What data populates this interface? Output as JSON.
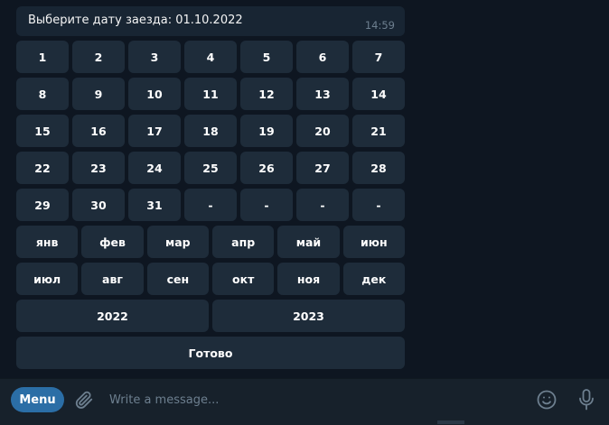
{
  "message": {
    "text": "Выберите дату заезда: 01.10.2022",
    "time": "14:59"
  },
  "keyboard": {
    "day_rows": [
      [
        "1",
        "2",
        "3",
        "4",
        "5",
        "6",
        "7"
      ],
      [
        "8",
        "9",
        "10",
        "11",
        "12",
        "13",
        "14"
      ],
      [
        "15",
        "16",
        "17",
        "18",
        "19",
        "20",
        "21"
      ],
      [
        "22",
        "23",
        "24",
        "25",
        "26",
        "27",
        "28"
      ],
      [
        "29",
        "30",
        "31",
        "-",
        "-",
        "-",
        "-"
      ]
    ],
    "month_rows": [
      [
        "янв",
        "фев",
        "мар",
        "апр",
        "май",
        "июн"
      ],
      [
        "июл",
        "авг",
        "сен",
        "окт",
        "ноя",
        "дек"
      ]
    ],
    "years": [
      "2022",
      "2023"
    ],
    "done_label": "Готово"
  },
  "input_bar": {
    "menu_label": "Menu",
    "placeholder": "Write a message...",
    "attach_icon": "paperclip-icon",
    "emoji_icon": "smile-icon",
    "mic_icon": "microphone-icon"
  },
  "colors": {
    "background": "#0e1621",
    "bubble": "#182533",
    "button": "#1e2c3a",
    "input_bar": "#17212b",
    "accent": "#2b6ea6"
  }
}
